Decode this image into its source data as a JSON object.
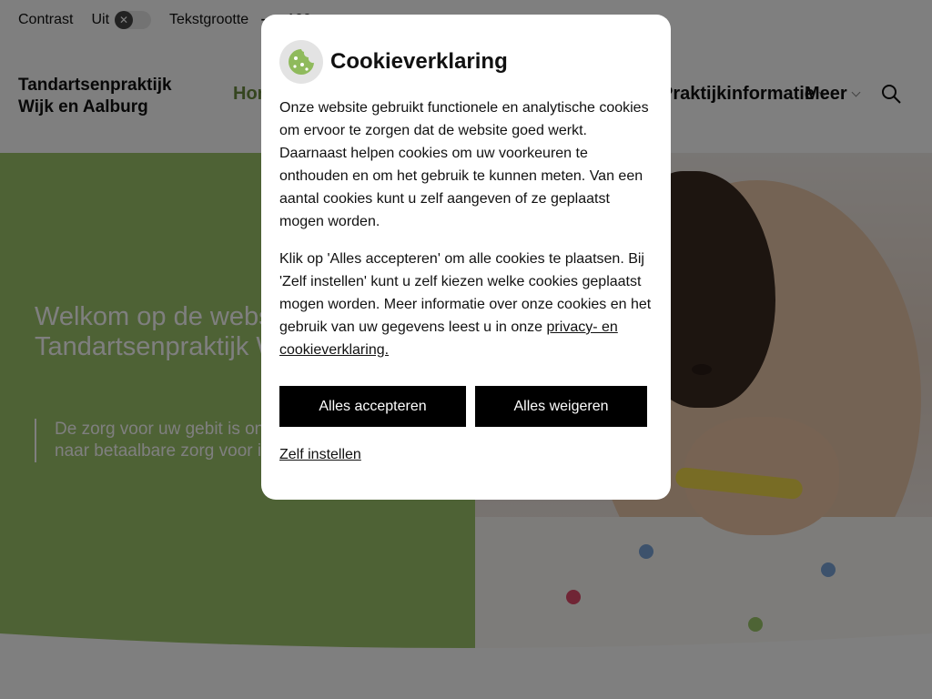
{
  "topbar": {
    "contrast_label": "Contrast",
    "contrast_state": "Uit",
    "contrast_toggle_glyph": "✕",
    "textsize_label": "Tekstgrootte",
    "textsize_minus": "—",
    "textsize_value": "100"
  },
  "header": {
    "brand_line1": "Tandartsenpraktijk",
    "brand_line2": "Wijk en Aalburg",
    "nav": {
      "home": "Home",
      "info": "Praktijkinformatie",
      "meer": "Meer"
    }
  },
  "hero": {
    "title": "Welkom op de website van Tandartsenpraktijk Wijk en Aalburg",
    "quote": "De zorg voor uw gebit is ons uitgangspunt. Op weg naar betaalbare zorg voor iedereen."
  },
  "cookie_dialog": {
    "title": "Cookieverklaring",
    "paragraph1": "Onze website gebruikt functionele en analytische cookies om ervoor te zorgen dat de website goed werkt. Daarnaast helpen cookies om uw voorkeuren te onthouden en om het gebruik te kunnen meten. Van een aantal cookies kunt u zelf aangeven of ze geplaatst mogen worden.",
    "paragraph2_text": "Klik op 'Alles accepteren' om alle cookies te plaatsen. Bij 'Zelf instellen' kunt u zelf kiezen welke cookies geplaatst mogen worden. Meer informatie over onze cookies en het gebruik van uw gegevens leest u in onze ",
    "paragraph2_link": "privacy- en cookieverklaring.",
    "accept_label": "Alles accepteren",
    "refuse_label": "Alles weigeren",
    "settings_label": "Zelf instellen"
  },
  "colors": {
    "hero_green": "#9dc46b",
    "nav_active": "#6a8a3f",
    "button_bg": "#000000",
    "overlay": "rgba(0,0,0,0.5)"
  },
  "icons": {
    "cookie": "cookie-icon",
    "search": "search-icon",
    "chevron": "chevron-down-icon",
    "toggle": "close-icon"
  }
}
